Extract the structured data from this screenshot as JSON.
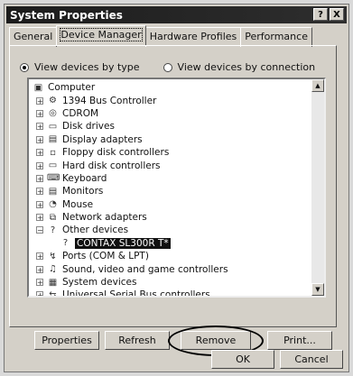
{
  "window": {
    "title": "System Properties",
    "title_buttons": [
      {
        "label": "?"
      },
      {
        "label": "X"
      }
    ]
  },
  "tabs": [
    {
      "label": "General"
    },
    {
      "label": "Device Manager"
    },
    {
      "label": "Hardware Profiles"
    },
    {
      "label": "Performance"
    }
  ],
  "view": {
    "by_type_label": "View devices by type",
    "by_connection_label": "View devices by connection",
    "selected": "by type"
  },
  "tree": {
    "items": [
      {
        "label": "Computer",
        "icon": "computer-icon"
      },
      {
        "label": "1394 Bus Controller",
        "icon": "bus-icon",
        "toggle": "+"
      },
      {
        "label": "CDROM",
        "icon": "cdrom-icon",
        "toggle": "+"
      },
      {
        "label": "Disk drives",
        "icon": "disk-icon",
        "toggle": "+"
      },
      {
        "label": "Display adapters",
        "icon": "display-icon",
        "toggle": "+"
      },
      {
        "label": "Floppy disk controllers",
        "icon": "floppy-icon",
        "toggle": "+"
      },
      {
        "label": "Hard disk controllers",
        "icon": "harddisk-icon",
        "toggle": "+"
      },
      {
        "label": "Keyboard",
        "icon": "keyboard-icon",
        "toggle": "+"
      },
      {
        "label": "Monitors",
        "icon": "monitor-icon",
        "toggle": "+"
      },
      {
        "label": "Mouse",
        "icon": "mouse-icon",
        "toggle": "+"
      },
      {
        "label": "Network adapters",
        "icon": "network-icon",
        "toggle": "+"
      },
      {
        "label": "Other devices",
        "icon": "question-icon",
        "toggle": "−"
      },
      {
        "label": "CONTAX SL300R T*",
        "icon": "question-icon",
        "selected": true
      },
      {
        "label": "Ports (COM & LPT)",
        "icon": "ports-icon",
        "toggle": "+"
      },
      {
        "label": "Sound, video and game controllers",
        "icon": "sound-icon",
        "toggle": "+"
      },
      {
        "label": "System devices",
        "icon": "system-icon",
        "toggle": "+"
      },
      {
        "label": "Universal Serial Bus controllers",
        "icon": "usb-icon",
        "toggle": "+"
      }
    ]
  },
  "buttons": {
    "properties": "Properties",
    "refresh": "Refresh",
    "remove": "Remove",
    "print": "Print...",
    "ok": "OK",
    "cancel": "Cancel"
  },
  "colors": {
    "dialog": "#d4d0c8",
    "titlebar": "#1c1c1c",
    "selection": "#111111"
  }
}
